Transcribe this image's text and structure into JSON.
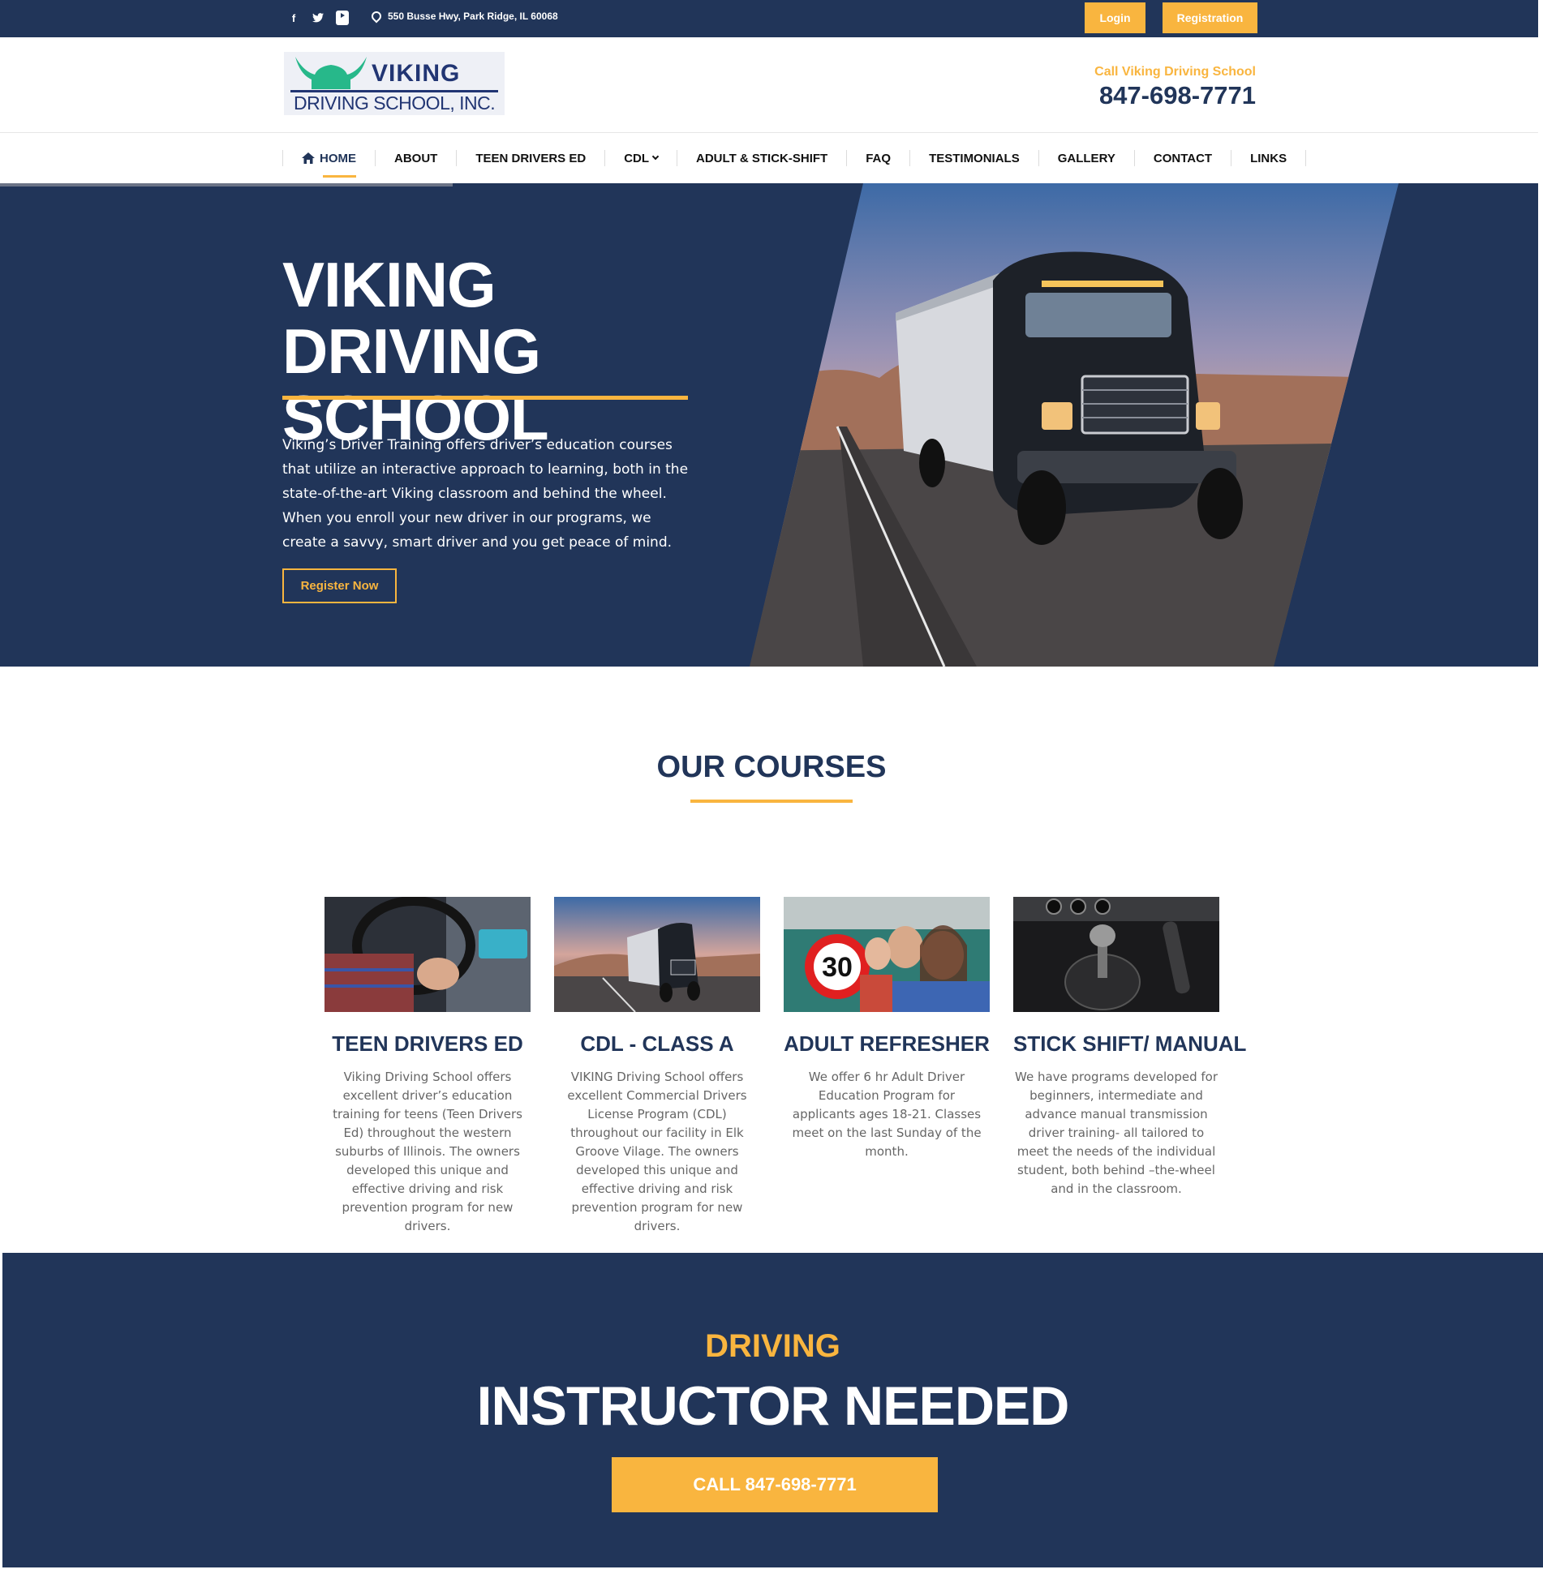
{
  "topbar": {
    "address": "550 Busse Hwy, Park Ridge, IL 60068",
    "login_label": "Login",
    "registration_label": "Registration",
    "social": [
      "facebook-icon",
      "twitter-icon",
      "youtube-icon"
    ]
  },
  "header": {
    "logo_line1": "VIKING",
    "logo_line2": "DRIVING SCHOOL, INC.",
    "call_label": "Call Viking Driving School",
    "phone": "847-698-7771"
  },
  "nav": {
    "items": [
      "HOME",
      "ABOUT",
      "TEEN DRIVERS ED",
      "CDL",
      "ADULT & STICK-SHIFT",
      "FAQ",
      "TESTIMONIALS",
      "GALLERY",
      "CONTACT",
      "LINKS"
    ],
    "active": "HOME"
  },
  "hero": {
    "title_line1": "VIKING DRIVING",
    "title_line2": "SCHOOL",
    "text": "Viking’s Driver Training offers driver’s education courses that utilize an interactive approach to learning, both in the state-of-the-art Viking classroom and behind the wheel. When you enroll your new driver in our programs, we create a savvy, smart driver and you get peace of mind.",
    "button_label": "Register Now",
    "image_alt": "MACK"
  },
  "courses": {
    "title": "OUR COURSES",
    "items": [
      {
        "title": "TEEN DRIVERS ED",
        "text": "Viking Driving School offers excellent driver’s education training for teens (Teen Drivers Ed) throughout the western suburbs of Illinois. The owners developed this unique and effective driving and risk prevention program for new drivers."
      },
      {
        "title": "CDL - CLASS A",
        "text": "VIKING Driving School offers excellent Commercial Drivers License Program (CDL) throughout our facility in Elk Groove Vilage. The owners developed this unique and effective driving and risk prevention program for new drivers."
      },
      {
        "title": "ADULT REFRESHER",
        "text": "We offer 6 hr Adult Driver Education Program for applicants ages 18-21. Classes meet on the last Sunday of the month.",
        "sign_text": "30"
      },
      {
        "title": "STICK SHIFT/ MANUAL",
        "text": "We have programs developed for beginners, intermediate and advance manual transmission driver training- all tailored to meet the needs of the individual student, both behind –the-wheel and in the classroom."
      }
    ]
  },
  "banner": {
    "small": "DRIVING",
    "big": "INSTRUCTOR NEEDED",
    "button_label": "CALL 847-698-7771"
  },
  "colors": {
    "navy": "#213559",
    "accent": "#f9b53f",
    "logo_green": "#27b88a"
  }
}
